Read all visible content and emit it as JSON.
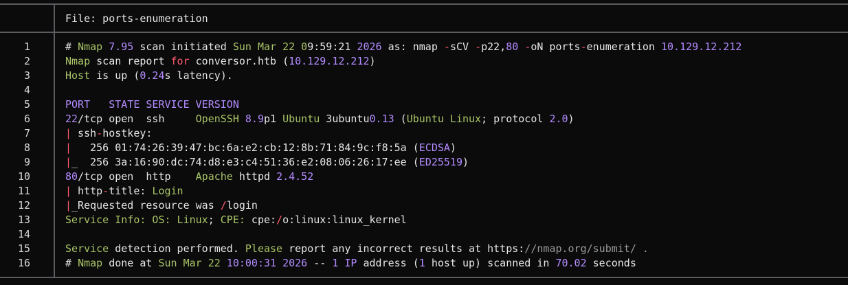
{
  "header": {
    "file_label": "File: ports-enumeration"
  },
  "colors": {
    "normal": "#e6e6e6",
    "purple": "#b48cff",
    "green": "#a9c466",
    "red": "#ff5a6e",
    "gray": "#9a9a9a",
    "border": "#5b5b60",
    "background": "#0b0b0c"
  },
  "lines": [
    {
      "n": "1",
      "segments": [
        {
          "t": "# ",
          "c": "normal"
        },
        {
          "t": "Nmap",
          "c": "green"
        },
        {
          "t": " ",
          "c": "normal"
        },
        {
          "t": "7.95",
          "c": "purple"
        },
        {
          "t": " scan initiated ",
          "c": "normal"
        },
        {
          "t": "Sun Mar 22 0",
          "c": "green"
        },
        {
          "t": "9:59:21",
          "c": "normal"
        },
        {
          "t": " ",
          "c": "normal"
        },
        {
          "t": "2026",
          "c": "purple"
        },
        {
          "t": " as: nmap ",
          "c": "normal"
        },
        {
          "t": "-",
          "c": "red"
        },
        {
          "t": "sCV ",
          "c": "normal"
        },
        {
          "t": "-",
          "c": "red"
        },
        {
          "t": "p22,",
          "c": "normal"
        },
        {
          "t": "80",
          "c": "purple"
        },
        {
          "t": " ",
          "c": "normal"
        },
        {
          "t": "-",
          "c": "red"
        },
        {
          "t": "oN ports",
          "c": "normal"
        },
        {
          "t": "-",
          "c": "red"
        },
        {
          "t": "enumeration ",
          "c": "normal"
        },
        {
          "t": "10.129.12.212",
          "c": "purple"
        }
      ]
    },
    {
      "n": "2",
      "segments": [
        {
          "t": "Nmap",
          "c": "green"
        },
        {
          "t": " scan report ",
          "c": "normal"
        },
        {
          "t": "for",
          "c": "red"
        },
        {
          "t": " conversor.htb (",
          "c": "normal"
        },
        {
          "t": "10.129.12.212",
          "c": "purple"
        },
        {
          "t": ")",
          "c": "normal"
        }
      ]
    },
    {
      "n": "3",
      "segments": [
        {
          "t": "Host",
          "c": "green"
        },
        {
          "t": " is up (",
          "c": "normal"
        },
        {
          "t": "0.24",
          "c": "purple"
        },
        {
          "t": "s latency).",
          "c": "normal"
        }
      ]
    },
    {
      "n": "4",
      "segments": []
    },
    {
      "n": "5",
      "segments": [
        {
          "t": "PORT   STATE SERVICE VERSION",
          "c": "purple"
        }
      ]
    },
    {
      "n": "6",
      "segments": [
        {
          "t": "22",
          "c": "purple"
        },
        {
          "t": "/tcp open  ssh     ",
          "c": "normal"
        },
        {
          "t": "OpenSSH",
          "c": "green"
        },
        {
          "t": " ",
          "c": "normal"
        },
        {
          "t": "8.9",
          "c": "purple"
        },
        {
          "t": "p1 ",
          "c": "normal"
        },
        {
          "t": "Ubuntu",
          "c": "green"
        },
        {
          "t": " 3ubuntu",
          "c": "normal"
        },
        {
          "t": "0.13",
          "c": "purple"
        },
        {
          "t": " (",
          "c": "normal"
        },
        {
          "t": "Ubuntu Linux",
          "c": "green"
        },
        {
          "t": "; protocol ",
          "c": "normal"
        },
        {
          "t": "2.0",
          "c": "purple"
        },
        {
          "t": ")",
          "c": "normal"
        }
      ]
    },
    {
      "n": "7",
      "segments": [
        {
          "t": "|",
          "c": "red"
        },
        {
          "t": " ssh",
          "c": "normal"
        },
        {
          "t": "-",
          "c": "red"
        },
        {
          "t": "hostkey:",
          "c": "normal"
        }
      ]
    },
    {
      "n": "8",
      "segments": [
        {
          "t": "|",
          "c": "red"
        },
        {
          "t": "   256 01:74:26:39:47:bc:6a:e2:cb:12:8b:71:84:9c:f8:5a (",
          "c": "normal"
        },
        {
          "t": "ECDSA",
          "c": "purple"
        },
        {
          "t": ")",
          "c": "normal"
        }
      ]
    },
    {
      "n": "9",
      "segments": [
        {
          "t": "|",
          "c": "red"
        },
        {
          "t": "_  256 3a:16:90:dc:74:d8:e3:c4:51:36:e2:08:06:26:17:ee (",
          "c": "normal"
        },
        {
          "t": "ED25519",
          "c": "purple"
        },
        {
          "t": ")",
          "c": "normal"
        }
      ]
    },
    {
      "n": "10",
      "segments": [
        {
          "t": "80",
          "c": "purple"
        },
        {
          "t": "/tcp open  http    ",
          "c": "normal"
        },
        {
          "t": "Apache",
          "c": "green"
        },
        {
          "t": " httpd ",
          "c": "normal"
        },
        {
          "t": "2.4.52",
          "c": "purple"
        }
      ]
    },
    {
      "n": "11",
      "segments": [
        {
          "t": "|",
          "c": "red"
        },
        {
          "t": " http",
          "c": "normal"
        },
        {
          "t": "-",
          "c": "red"
        },
        {
          "t": "title: ",
          "c": "normal"
        },
        {
          "t": "Login",
          "c": "green"
        }
      ]
    },
    {
      "n": "12",
      "segments": [
        {
          "t": "|",
          "c": "red"
        },
        {
          "t": "_Requested resource was ",
          "c": "normal"
        },
        {
          "t": "/",
          "c": "red"
        },
        {
          "t": "login",
          "c": "normal"
        }
      ]
    },
    {
      "n": "13",
      "segments": [
        {
          "t": "Service Info: OS: Linux",
          "c": "green"
        },
        {
          "t": "; ",
          "c": "normal"
        },
        {
          "t": "CPE:",
          "c": "green"
        },
        {
          "t": " cpe:",
          "c": "normal"
        },
        {
          "t": "/",
          "c": "red"
        },
        {
          "t": "o:linux:linux_kernel",
          "c": "normal"
        }
      ]
    },
    {
      "n": "14",
      "segments": []
    },
    {
      "n": "15",
      "segments": [
        {
          "t": "Service",
          "c": "green"
        },
        {
          "t": " detection performed. ",
          "c": "normal"
        },
        {
          "t": "Please",
          "c": "green"
        },
        {
          "t": " report any incorrect results at https:",
          "c": "normal"
        },
        {
          "t": "//nmap.org/submit/ .",
          "c": "gray"
        }
      ]
    },
    {
      "n": "16",
      "segments": [
        {
          "t": "# ",
          "c": "normal"
        },
        {
          "t": "Nmap",
          "c": "green"
        },
        {
          "t": " done at ",
          "c": "normal"
        },
        {
          "t": "Sun Mar 22",
          "c": "green"
        },
        {
          "t": " ",
          "c": "normal"
        },
        {
          "t": "10:00:31",
          "c": "purple"
        },
        {
          "t": " ",
          "c": "normal"
        },
        {
          "t": "2026",
          "c": "purple"
        },
        {
          "t": " -- ",
          "c": "normal"
        },
        {
          "t": "1",
          "c": "purple"
        },
        {
          "t": " ",
          "c": "normal"
        },
        {
          "t": "IP",
          "c": "purple"
        },
        {
          "t": " address (",
          "c": "normal"
        },
        {
          "t": "1",
          "c": "purple"
        },
        {
          "t": " host up) scanned in ",
          "c": "normal"
        },
        {
          "t": "70.02",
          "c": "purple"
        },
        {
          "t": " seconds",
          "c": "normal"
        }
      ]
    }
  ]
}
